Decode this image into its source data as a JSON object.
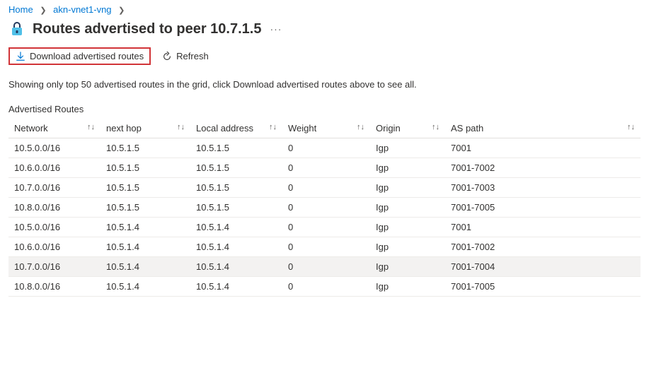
{
  "breadcrumb": {
    "home": "Home",
    "resource": "akn-vnet1-vng"
  },
  "title": "Routes advertised to peer 10.7.1.5",
  "toolbar": {
    "download_label": "Download advertised routes",
    "refresh_label": "Refresh"
  },
  "info_text": "Showing only top 50 advertised routes in the grid, click Download advertised routes above to see all.",
  "table_title": "Advertised Routes",
  "columns": {
    "network": "Network",
    "nexthop": "next hop",
    "localaddress": "Local address",
    "weight": "Weight",
    "origin": "Origin",
    "aspath": "AS path"
  },
  "rows": [
    {
      "network": "10.5.0.0/16",
      "nexthop": "10.5.1.5",
      "localaddress": "10.5.1.5",
      "weight": "0",
      "origin": "Igp",
      "aspath": "7001"
    },
    {
      "network": "10.6.0.0/16",
      "nexthop": "10.5.1.5",
      "localaddress": "10.5.1.5",
      "weight": "0",
      "origin": "Igp",
      "aspath": "7001-7002"
    },
    {
      "network": "10.7.0.0/16",
      "nexthop": "10.5.1.5",
      "localaddress": "10.5.1.5",
      "weight": "0",
      "origin": "Igp",
      "aspath": "7001-7003"
    },
    {
      "network": "10.8.0.0/16",
      "nexthop": "10.5.1.5",
      "localaddress": "10.5.1.5",
      "weight": "0",
      "origin": "Igp",
      "aspath": "7001-7005"
    },
    {
      "network": "10.5.0.0/16",
      "nexthop": "10.5.1.4",
      "localaddress": "10.5.1.4",
      "weight": "0",
      "origin": "Igp",
      "aspath": "7001"
    },
    {
      "network": "10.6.0.0/16",
      "nexthop": "10.5.1.4",
      "localaddress": "10.5.1.4",
      "weight": "0",
      "origin": "Igp",
      "aspath": "7001-7002"
    },
    {
      "network": "10.7.0.0/16",
      "nexthop": "10.5.1.4",
      "localaddress": "10.5.1.4",
      "weight": "0",
      "origin": "Igp",
      "aspath": "7001-7004",
      "hover": true
    },
    {
      "network": "10.8.0.0/16",
      "nexthop": "10.5.1.4",
      "localaddress": "10.5.1.4",
      "weight": "0",
      "origin": "Igp",
      "aspath": "7001-7005"
    }
  ]
}
